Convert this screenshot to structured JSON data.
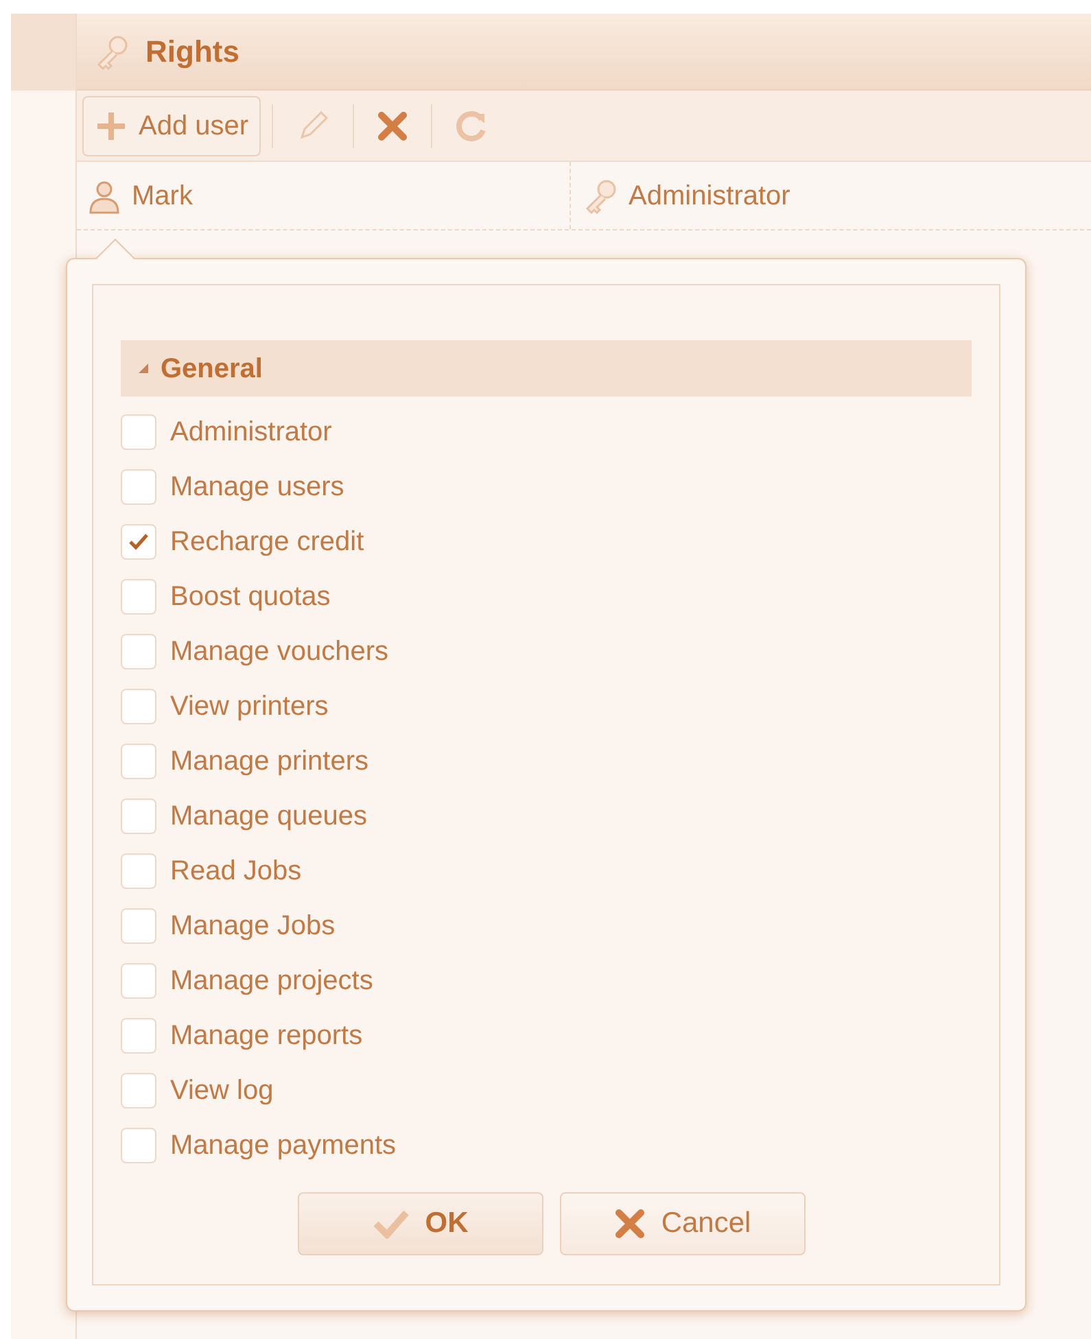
{
  "panel": {
    "title": "Rights"
  },
  "toolbar": {
    "add_button": "Add user"
  },
  "row": {
    "user": "Mark",
    "role": "Administrator"
  },
  "popup": {
    "section": {
      "title": "General",
      "expanded": true
    },
    "rights": [
      {
        "label": "Administrator",
        "checked": false
      },
      {
        "label": "Manage users",
        "checked": false
      },
      {
        "label": "Recharge credit",
        "checked": true
      },
      {
        "label": "Boost quotas",
        "checked": false
      },
      {
        "label": "Manage vouchers",
        "checked": false
      },
      {
        "label": "View printers",
        "checked": false
      },
      {
        "label": "Manage printers",
        "checked": false
      },
      {
        "label": "Manage queues",
        "checked": false
      },
      {
        "label": "Read Jobs",
        "checked": false
      },
      {
        "label": "Manage Jobs",
        "checked": false
      },
      {
        "label": "Manage projects",
        "checked": false
      },
      {
        "label": "Manage reports",
        "checked": false
      },
      {
        "label": "View log",
        "checked": false
      },
      {
        "label": "Manage payments",
        "checked": false
      }
    ],
    "ok_button": "OK",
    "cancel_button": "Cancel"
  }
}
